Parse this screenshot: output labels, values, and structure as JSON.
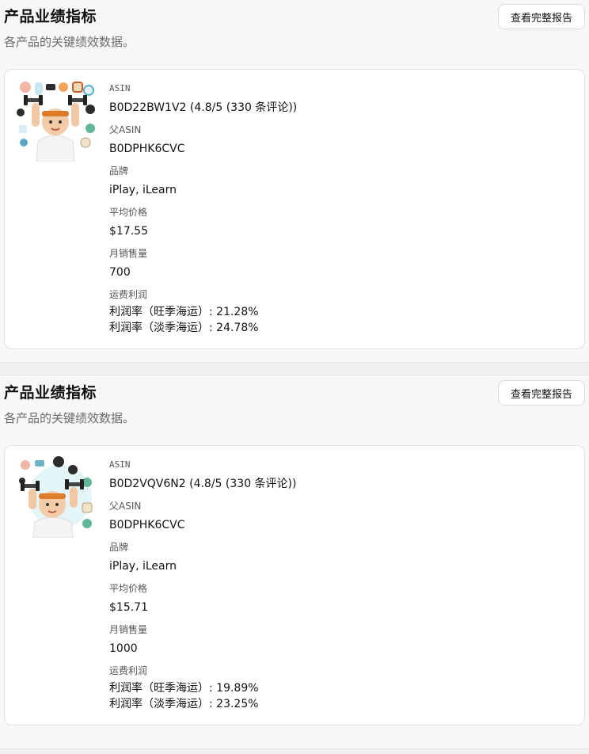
{
  "sections": [
    {
      "title": "产品业绩指标",
      "subtitle": "各产品的关键绩效数据。",
      "report_button": "查看完整报告",
      "product": {
        "asin_label": "ASIN",
        "asin_value": "B0D22BW1V2 (4.8/5 (330 条评论))",
        "parent_asin_label": "父ASIN",
        "parent_asin_value": "B0DPHK6CVC",
        "brand_label": "品牌",
        "brand_value": "iPlay, iLearn",
        "avg_price_label": "平均价格",
        "avg_price_value": "$17.55",
        "monthly_sales_label": "月销售量",
        "monthly_sales_value": "700",
        "profit_label": "运费利润",
        "margin_peak": "利润率（旺季海运）: 21.28%",
        "margin_off": "利润率（淡季海运）: 24.78%"
      }
    },
    {
      "title": "产品业绩指标",
      "subtitle": "各产品的关键绩效数据。",
      "report_button": "查看完整报告",
      "product": {
        "asin_label": "ASIN",
        "asin_value": "B0D2VQV6N2 (4.8/5 (330 条评论))",
        "parent_asin_label": "父ASIN",
        "parent_asin_value": "B0DPHK6CVC",
        "brand_label": "品牌",
        "brand_value": "iPlay, iLearn",
        "avg_price_label": "平均价格",
        "avg_price_value": "$15.71",
        "monthly_sales_label": "月销售量",
        "monthly_sales_value": "1000",
        "profit_label": "运费利润",
        "margin_peak": "利润率（旺季海运）: 19.89%",
        "margin_off": "利润率（淡季海运）: 23.25%"
      }
    }
  ],
  "colors": {
    "page_bg": "#f7f7f7",
    "card_bg": "#ffffff",
    "muted_text": "#6b6b6b",
    "headband": "#e07a2b"
  },
  "icons": {
    "product_image": "baby-dumbbell-toy-photo"
  }
}
